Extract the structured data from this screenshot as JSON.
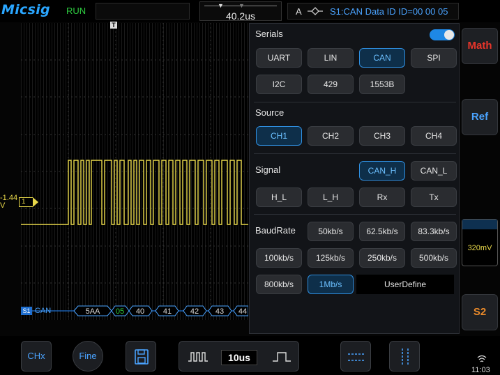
{
  "header": {
    "brand": "Micsig",
    "run_state": "RUN",
    "timebase_offset": "40.2us",
    "trigger_source": "A",
    "trigger_edge_icon": "trigger-edge-icon",
    "trigger_text": "S1:CAN Data ID ID=00 00 05"
  },
  "waveform": {
    "trigger_marker": "T",
    "ch1_offset_label": "-1.44\nV",
    "ch1_flag": "1",
    "bus_tag": "S1",
    "bus_name": "CAN",
    "decode_frames": [
      "5AA",
      "05",
      "40",
      "41",
      "42",
      "43",
      "44"
    ]
  },
  "serial_panel": {
    "title": "Serials",
    "enabled": true,
    "protocols": [
      "UART",
      "LIN",
      "CAN",
      "SPI",
      "I2C",
      "429",
      "1553B"
    ],
    "selected_protocol": "CAN",
    "source_label": "Source",
    "sources": [
      "CH1",
      "CH2",
      "CH3",
      "CH4"
    ],
    "selected_source": "CH1",
    "signal_label": "Signal",
    "signals": [
      "CAN_H",
      "CAN_L",
      "H_L",
      "L_H",
      "Rx",
      "Tx"
    ],
    "selected_signal": "CAN_H",
    "baudrate_label": "BaudRate",
    "baudrates": [
      "50kb/s",
      "62.5kb/s",
      "83.3kb/s",
      "100kb/s",
      "125kb/s",
      "250kb/s",
      "500kb/s",
      "800kb/s",
      "1Mb/s"
    ],
    "selected_baudrate": "1Mb/s",
    "user_define": "UserDefine"
  },
  "side": {
    "math": "Math",
    "ref": "Ref",
    "ch_scale": "320mV",
    "s2": "S2"
  },
  "bottom": {
    "chx": "CHx",
    "fine": "Fine",
    "save_icon": "save-icon",
    "timebase": "10us",
    "clock": "11:03"
  },
  "colors": {
    "accent": "#4aa3ff",
    "ch1": "#e8d84a",
    "math": "#e8352a",
    "s2": "#e8892a",
    "run": "#2ecc40"
  }
}
